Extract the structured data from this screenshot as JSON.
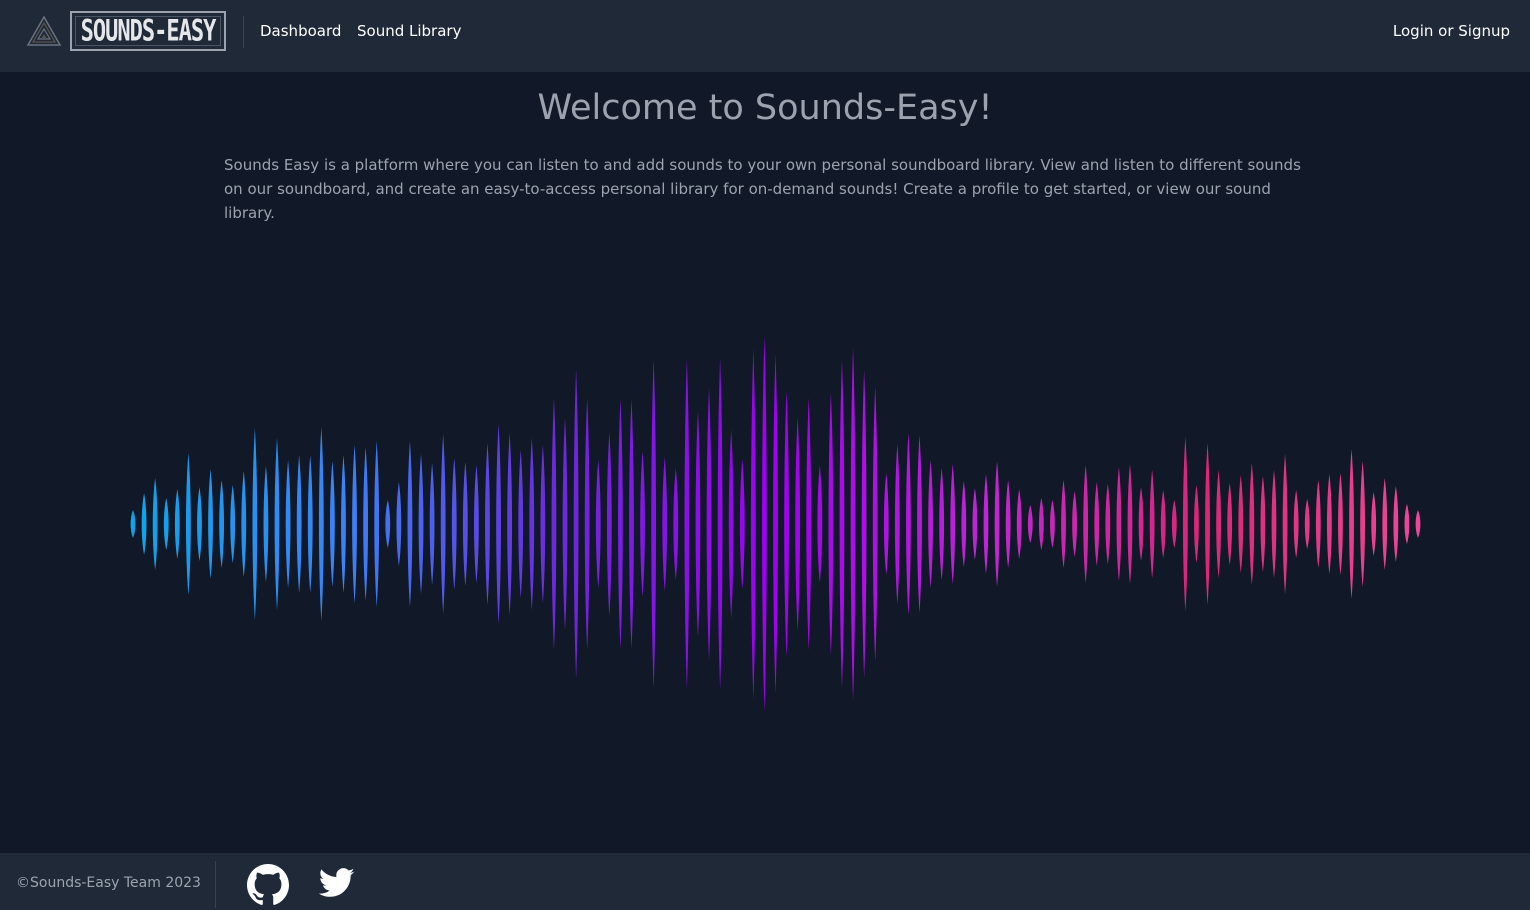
{
  "header": {
    "logo_text": "SOUNDS-EASY",
    "nav": {
      "dashboard": "Dashboard",
      "sound_library": "Sound Library"
    },
    "login": "Login or Signup"
  },
  "main": {
    "title": "Welcome to Sounds-Easy!",
    "intro": "Sounds Easy is a platform where you can listen to and add sounds to your own personal soundboard library. View and listen to different sounds on our soundboard, and create an easy-to-access personal library for on-demand sounds! Create a profile to get started, or view our sound library."
  },
  "waveform": {
    "gradient_colors": [
      "#0ea5e9",
      "#3b82f6",
      "#6d28d9",
      "#9f00f0",
      "#c026d3",
      "#db2777",
      "#ec4899"
    ],
    "bar_levels": [
      0.14,
      0.31,
      0.46,
      0.26,
      0.35,
      0.71,
      0.37,
      0.55,
      0.44,
      0.39,
      0.53,
      0.96,
      0.58,
      0.86,
      0.64,
      0.69,
      0.69,
      0.97,
      0.63,
      0.69,
      0.79,
      0.77,
      0.83,
      0.24,
      0.42,
      0.83,
      0.7,
      0.61,
      0.9,
      0.66,
      0.62,
      0.59,
      0.81,
      1.0,
      0.91,
      0.74,
      0.86,
      0.79,
      1.26,
      1.06,
      1.55,
      1.26,
      0.64,
      0.92,
      1.25,
      1.25,
      0.73,
      1.65,
      0.67,
      0.56,
      1.65,
      1.13,
      1.36,
      1.66,
      0.94,
      0.65,
      1.75,
      1.88,
      1.7,
      1.33,
      1.07,
      1.26,
      0.59,
      1.31,
      1.64,
      1.76,
      1.54,
      1.37,
      0.51,
      0.8,
      0.91,
      0.89,
      0.64,
      0.56,
      0.6,
      0.43,
      0.36,
      0.5,
      0.63,
      0.44,
      0.35,
      0.19,
      0.26,
      0.24,
      0.44,
      0.33,
      0.59,
      0.42,
      0.4,
      0.57,
      0.6,
      0.37,
      0.54,
      0.34,
      0.24,
      0.87,
      0.39,
      0.81,
      0.54,
      0.41,
      0.49,
      0.61,
      0.48,
      0.54,
      0.7,
      0.34,
      0.25,
      0.44,
      0.5,
      0.51,
      0.75,
      0.63,
      0.32,
      0.46,
      0.38,
      0.2,
      0.14
    ]
  },
  "footer": {
    "copyright": "©Sounds-Easy Team 2023"
  }
}
